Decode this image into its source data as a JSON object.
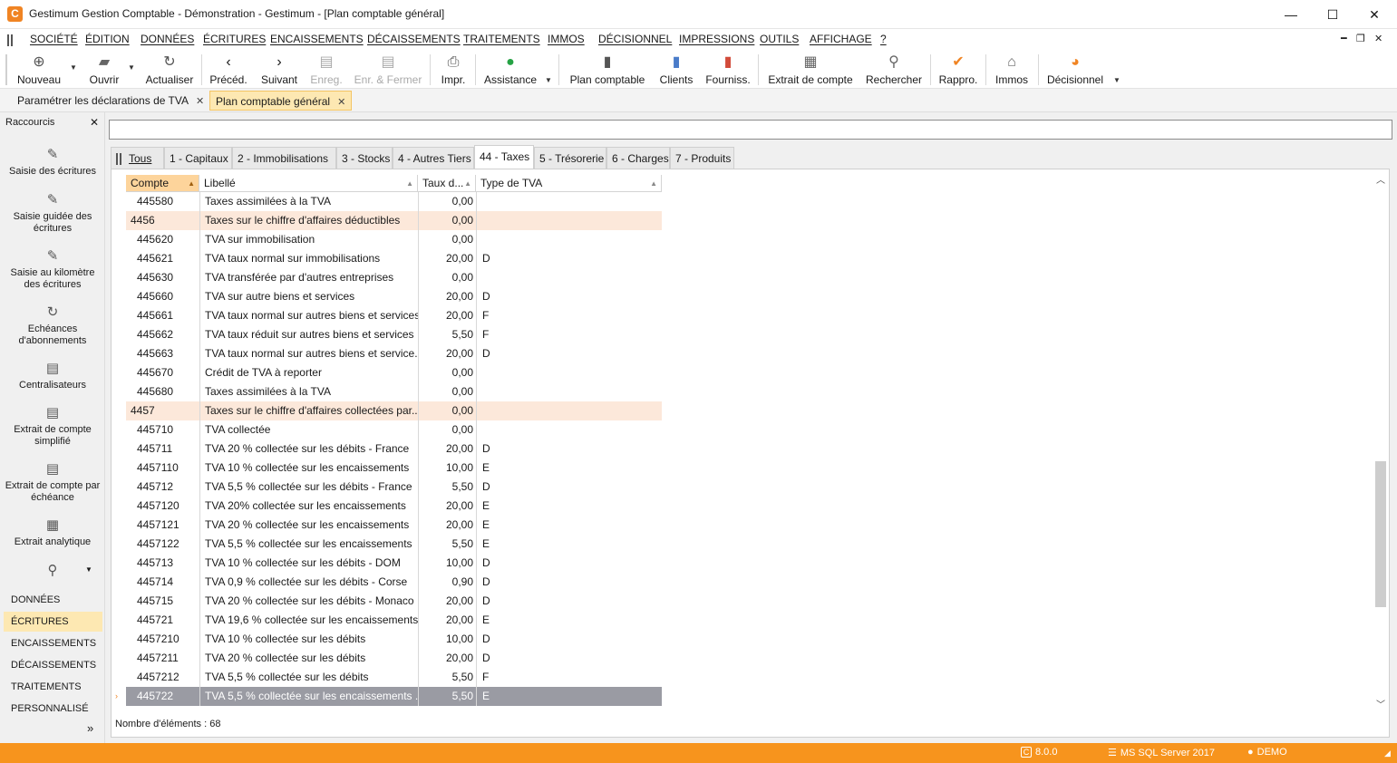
{
  "window": {
    "title": "Gestimum Gestion Comptable - Démonstration - Gestimum - [Plan comptable général]",
    "logo_letter": "C",
    "controls": {
      "minimize": "—",
      "maximize": "☐",
      "close": "✕"
    }
  },
  "menu": {
    "items": [
      "SOCIÉTÉ",
      "ÉDITION",
      "DONNÉES",
      "ÉCRITURES",
      "ENCAISSEMENTS",
      "DÉCAISSEMENTS",
      "TRAITEMENTS",
      "IMMOS",
      "DÉCISIONNEL",
      "IMPRESSIONS",
      "OUTILS",
      "AFFICHAGE",
      "?"
    ],
    "mdi_controls": {
      "minimize": "━",
      "restore": "❐",
      "close": "✕"
    }
  },
  "toolbar": {
    "nouveau": "Nouveau",
    "ouvrir": "Ouvrir",
    "actualiser": "Actualiser",
    "preced": "Précéd.",
    "suivant": "Suivant",
    "enreg": "Enreg.",
    "enr_fermer": "Enr. & Fermer",
    "impr": "Impr.",
    "assistance": "Assistance",
    "plan_comptable": "Plan comptable",
    "clients": "Clients",
    "fourniss": "Fourniss.",
    "extrait_compte": "Extrait de compte",
    "rechercher": "Rechercher",
    "rappro": "Rappro.",
    "immos": "Immos",
    "decisionnel": "Décisionnel"
  },
  "doc_tabs": [
    {
      "label": "Paramétrer les déclarations de TVA",
      "close": "✕"
    },
    {
      "label": "Plan comptable général",
      "close": "✕"
    }
  ],
  "sidebar": {
    "title": "Raccourcis",
    "close": "✕",
    "shortcuts": [
      "Saisie des écritures",
      "Saisie guidée des écritures",
      "Saisie au kilomètre des écritures",
      "Echéances d'abonnements",
      "Centralisateurs",
      "Extrait de compte simplifié",
      "Extrait de compte par échéance",
      "Extrait analytique"
    ],
    "categories": [
      "DONNÉES",
      "ÉCRITURES",
      "ENCAISSEMENTS",
      "DÉCAISSEMENTS",
      "TRAITEMENTS",
      "PERSONNALISÉ"
    ],
    "active_category": "ÉCRITURES",
    "expand": "»"
  },
  "tabs": [
    {
      "label": "Tous"
    },
    {
      "label": "1 - Capitaux"
    },
    {
      "label": "2 - Immobilisations"
    },
    {
      "label": "3 - Stocks"
    },
    {
      "label": "4 - Autres Tiers"
    },
    {
      "label": "44 - Taxes"
    },
    {
      "label": "5 - Trésorerie"
    },
    {
      "label": "6 - Charges"
    },
    {
      "label": "7 - Produits"
    }
  ],
  "active_tab": "44 - Taxes",
  "grid": {
    "columns": {
      "compte": "Compte",
      "libelle": "Libellé",
      "taux": "Taux d...",
      "type": "Type de TVA"
    },
    "rows": [
      {
        "compte": "445580",
        "libelle": "Taxes assimilées à la TVA",
        "taux": "0,00",
        "type": ""
      },
      {
        "compte": "4456",
        "libelle": "Taxes sur le chiffre d'affaires déductibles",
        "taux": "0,00",
        "type": "",
        "parent": true
      },
      {
        "compte": "445620",
        "libelle": "TVA sur immobilisation",
        "taux": "0,00",
        "type": ""
      },
      {
        "compte": "445621",
        "libelle": "TVA taux normal sur immobilisations",
        "taux": "20,00",
        "type": "D"
      },
      {
        "compte": "445630",
        "libelle": "TVA transférée par d'autres entreprises",
        "taux": "0,00",
        "type": ""
      },
      {
        "compte": "445660",
        "libelle": "TVA sur autre biens et services",
        "taux": "20,00",
        "type": "D"
      },
      {
        "compte": "445661",
        "libelle": "TVA taux normal sur autres biens et services",
        "taux": "20,00",
        "type": "F"
      },
      {
        "compte": "445662",
        "libelle": "TVA taux réduit sur autres biens et services",
        "taux": "5,50",
        "type": "F"
      },
      {
        "compte": "445663",
        "libelle": "TVA taux normal sur autres biens et service...",
        "taux": "20,00",
        "type": "D"
      },
      {
        "compte": "445670",
        "libelle": "Crédit de TVA à reporter",
        "taux": "0,00",
        "type": ""
      },
      {
        "compte": "445680",
        "libelle": "Taxes assimilées à la TVA",
        "taux": "0,00",
        "type": ""
      },
      {
        "compte": "4457",
        "libelle": "Taxes sur le chiffre d'affaires collectées par...",
        "taux": "0,00",
        "type": "",
        "parent": true
      },
      {
        "compte": "445710",
        "libelle": "TVA collectée",
        "taux": "0,00",
        "type": ""
      },
      {
        "compte": "445711",
        "libelle": "TVA 20 % collectée sur les débits - France",
        "taux": "20,00",
        "type": "D"
      },
      {
        "compte": "4457110",
        "libelle": "TVA 10 % collectée sur les encaissements",
        "taux": "10,00",
        "type": "E"
      },
      {
        "compte": "445712",
        "libelle": "TVA 5,5 % collectée sur les débits - France",
        "taux": "5,50",
        "type": "D"
      },
      {
        "compte": "4457120",
        "libelle": "TVA 20% collectée sur les encaissements",
        "taux": "20,00",
        "type": "E"
      },
      {
        "compte": "4457121",
        "libelle": "TVA 20 % collectée sur les encaissements",
        "taux": "20,00",
        "type": "E"
      },
      {
        "compte": "4457122",
        "libelle": "TVA 5,5 % collectée sur les encaissements",
        "taux": "5,50",
        "type": "E"
      },
      {
        "compte": "445713",
        "libelle": "TVA 10 % collectée sur les débits - DOM",
        "taux": "10,00",
        "type": "D"
      },
      {
        "compte": "445714",
        "libelle": "TVA 0,9 % collectée sur les débits - Corse",
        "taux": "0,90",
        "type": "D"
      },
      {
        "compte": "445715",
        "libelle": "TVA 20 % collectée sur les débits - Monaco",
        "taux": "20,00",
        "type": "D"
      },
      {
        "compte": "445721",
        "libelle": "TVA 19,6 % collectée sur les encaissements...",
        "taux": "20,00",
        "type": "E"
      },
      {
        "compte": "4457210",
        "libelle": "TVA 10 % collectée sur les débits",
        "taux": "10,00",
        "type": "D"
      },
      {
        "compte": "4457211",
        "libelle": "TVA 20 % collectée sur les débits",
        "taux": "20,00",
        "type": "D"
      },
      {
        "compte": "4457212",
        "libelle": "TVA 5,5 % collectée sur les débits",
        "taux": "5,50",
        "type": "F"
      },
      {
        "compte": "445722",
        "libelle": "TVA 5,5 % collectée sur les encaissements ...",
        "taux": "5,50",
        "type": "E",
        "selected": true
      }
    ],
    "count_label": "Nombre d'éléments : 68"
  },
  "status": {
    "version": "8.0.0",
    "server": "MS SQL Server 2017",
    "user": "DEMO"
  },
  "colors": {
    "accent": "#f7941d",
    "active_tab": "#fde8b2",
    "parent_row": "#fce8da",
    "selected_row": "#9a9ba3"
  }
}
